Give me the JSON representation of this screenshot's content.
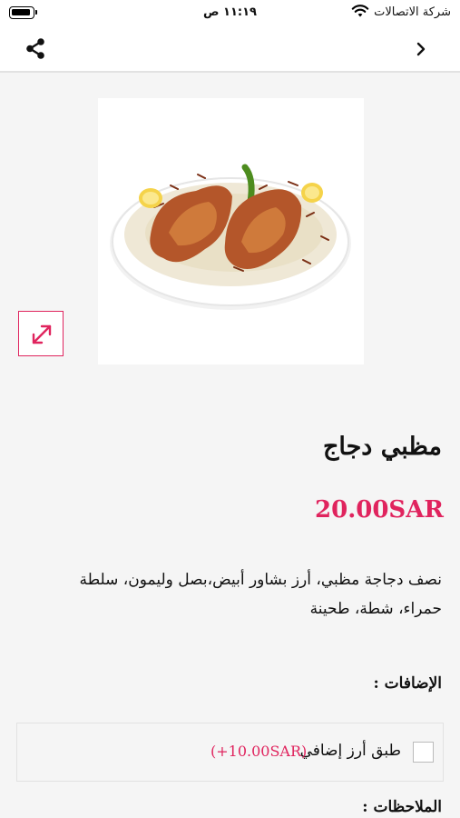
{
  "status_bar": {
    "carrier": "شركة الاتصالات",
    "time": "١١:١٩ ص"
  },
  "nav": {
    "share_icon": "share-icon",
    "back_icon": "chevron-right-icon"
  },
  "product": {
    "title": "مظبي دجاج",
    "price": "20.00SAR",
    "description": "نصف دجاجة مظبي، أرز بشاور أبيض،بصل وليمون، سلطة حمراء، شطة، طحينة",
    "expand_icon": "expand-arrows-icon"
  },
  "addons": {
    "heading": "الإضافات :",
    "items": [
      {
        "label": "طبق أرز إضافي",
        "price": "(+10.00SAR)",
        "checked": false
      }
    ]
  },
  "notes": {
    "heading": "الملاحظات :"
  },
  "colors": {
    "accent": "#e0245e",
    "border": "#e2e2e2",
    "background": "#f5f5f5"
  }
}
